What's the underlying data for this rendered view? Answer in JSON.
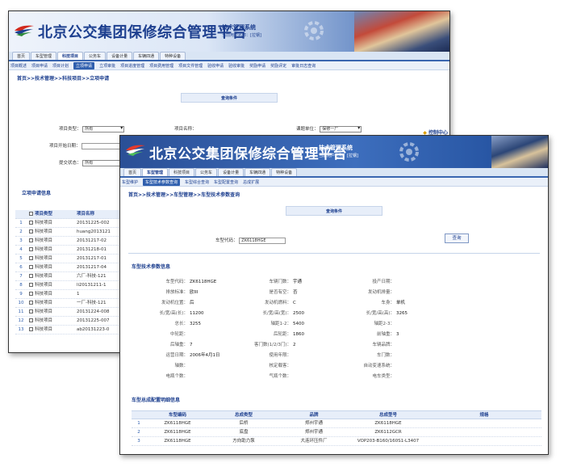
{
  "brand_color": "#1d3f8f",
  "accent_color": "#2f5fae",
  "back_window": {
    "banner": {
      "title": "北京公交集团保修综合管理平台",
      "subtitle": "技术管理系统",
      "user_line": "当前用户名称：[拉钢]",
      "logo_icon": "bus-group-logo-icon",
      "gear_icon": "gear-icon"
    },
    "tabs": [
      "首页",
      "车型管理",
      "科技项目",
      "公务车",
      "设备计量",
      "车辆四通",
      "特种设备"
    ],
    "active_tab": "科技项目",
    "subnav": [
      "项目概述",
      "项目申请",
      "项目计划",
      "立项申请",
      "立项审批",
      "项目进度管理",
      "项目费用管理",
      "项目文件管理",
      "验收申请",
      "验收审批",
      "奖励申请",
      "奖励评定",
      "审批日志查询"
    ],
    "active_subnav": "立项申请",
    "breadcrumb": "首页>>技术管理>>科技项目>>立项申请",
    "query_header": "查询条件",
    "filters": {
      "project_type_label": "项目类型：",
      "project_type_value": "所有",
      "project_name_label": "项目名称：",
      "apply_unit_label": "课题单位：",
      "apply_unit_value": "保修一厂",
      "start_date_label": "项目开始日期：",
      "status_label": "提交状态：",
      "status_value": "所有"
    },
    "control_center": "控制中心",
    "list_title": "立项申请信息",
    "list_headers": [
      "项目类型",
      "项目名称"
    ],
    "list_rows": [
      {
        "no": "1",
        "type": "科技项目",
        "name": "20131225-002"
      },
      {
        "no": "2",
        "type": "科技项目",
        "name": "huang2013121"
      },
      {
        "no": "3",
        "type": "科技项目",
        "name": "20131217-02"
      },
      {
        "no": "4",
        "type": "科技项目",
        "name": "20131218-01"
      },
      {
        "no": "5",
        "type": "科技项目",
        "name": "20131217-01"
      },
      {
        "no": "6",
        "type": "科技项目",
        "name": "20131217-04"
      },
      {
        "no": "7",
        "type": "科技项目",
        "name": "六厂-科技-121"
      },
      {
        "no": "8",
        "type": "科技项目",
        "name": "li20131211-1"
      },
      {
        "no": "9",
        "type": "科技项目",
        "name": "1"
      },
      {
        "no": "10",
        "type": "科技项目",
        "name": "一厂-科技-121"
      },
      {
        "no": "11",
        "type": "科技项目",
        "name": "20131224-008"
      },
      {
        "no": "12",
        "type": "科技项目",
        "name": "20131225-007"
      },
      {
        "no": "13",
        "type": "科技项目",
        "name": "ab20131223-0"
      }
    ]
  },
  "front_window": {
    "banner": {
      "title": "北京公交集团保修综合管理平台",
      "subtitle": "技术管理系统",
      "user_line": "当前用户名称：[拉钢]",
      "logo_icon": "bus-group-logo-icon",
      "gear_icon": "gear-icon"
    },
    "tabs": [
      "首页",
      "车型管理",
      "科技项目",
      "公务车",
      "设备计量",
      "车辆四通",
      "特种设备"
    ],
    "active_tab": "车型管理",
    "subnav": [
      "车型维护",
      "车型技术参数查询",
      "车型综合查询",
      "车型配置查询",
      "总成扩展"
    ],
    "active_subnav": "车型技术参数查询",
    "breadcrumb": "首页>>技术管理>>车型管理>>车型技术参数查询",
    "query_header": "查询条件",
    "model_code_label": "车型代码：",
    "model_code_value": "ZK6118HGE",
    "query_button": "查询",
    "params_title": "车型技术参数信息",
    "params": [
      [
        [
          "车型代码：",
          "ZK6118HGE"
        ],
        [
          "车辆门数：",
          "宇通"
        ],
        [
          "投产日期：",
          ""
        ],
        [
          "",
          ""
        ],
        [
          "燃油类型：",
          "柴油"
        ]
      ],
      [
        [
          "排放标准：",
          "欧III"
        ],
        [
          "是否有空：",
          "否"
        ],
        [
          "发动机排量：",
          ""
        ],
        [
          "",
          ""
        ],
        [
          "发动机额定功率：",
          "162"
        ]
      ],
      [
        [
          "发动机位置：",
          "后"
        ],
        [
          "发动机燃料：",
          "C"
        ],
        [
          "车身：",
          "单机"
        ],
        [
          "",
          ""
        ],
        [
          "悬挂形式：",
          "后悬"
        ]
      ],
      [
        [
          "长/宽/高(长)：",
          "11200"
        ],
        [
          "长/宽/高(宽)：",
          "2500"
        ],
        [
          "长/宽/高(高)：",
          "3265"
        ],
        [
          "",
          ""
        ],
        [
          "前悬：",
          "2545"
        ]
      ],
      [
        [
          "总长：",
          "3255"
        ],
        [
          "轴距1-2：",
          "5400"
        ],
        [
          "轴距2-3：",
          ""
        ],
        [
          "",
          ""
        ],
        [
          "前轮距：",
          "2054"
        ]
      ],
      [
        [
          "中轮距：",
          ""
        ],
        [
          "后轮距：",
          "1860"
        ],
        [
          "前轴重：",
          "3"
        ],
        [
          "",
          ""
        ],
        [
          "中轴重：",
          ""
        ]
      ],
      [
        [
          "后轴重：",
          "7"
        ],
        [
          "客门数(1/2/3门)：",
          "2"
        ],
        [
          "车辆品牌：",
          ""
        ],
        [
          "",
          ""
        ],
        [
          "轮胎数：",
          ""
        ]
      ],
      [
        [
          "运营日期：",
          "2006年4月1日"
        ],
        [
          "使用年限：",
          ""
        ],
        [
          "车门数：",
          ""
        ],
        [
          "",
          ""
        ],
        [
          "轴距：",
          ""
        ]
      ],
      [
        [
          "轴数：",
          ""
        ],
        [
          "核定载客：",
          ""
        ],
        [
          "自动变速系统：",
          ""
        ],
        [
          "",
          ""
        ],
        [
          "驻留个数：",
          ""
        ]
      ],
      [
        [
          "电瓶个数：",
          ""
        ],
        [
          "气瓶个数：",
          ""
        ],
        [
          "电车类型：",
          ""
        ],
        [
          "",
          ""
        ],
        [
          "父车型代码：",
          ""
        ]
      ]
    ],
    "assembly_title": "车型总成配置明细信息",
    "assembly_headers": [
      "",
      "车型编码",
      "总成类型",
      "品牌",
      "总成型号",
      "规格"
    ],
    "assembly_rows": [
      [
        "1",
        "ZK6118HGE",
        "后桥",
        "郑州宇通",
        "ZK6118HGE",
        ""
      ],
      [
        "2",
        "ZK6118HGE",
        "底盘",
        "郑州宇通",
        "ZK6112GCR",
        ""
      ],
      [
        "3",
        "ZK6118HGE",
        "方向助力泵",
        "大连环压件厂",
        "VOP203-B160/160S1-L3407",
        ""
      ]
    ]
  }
}
